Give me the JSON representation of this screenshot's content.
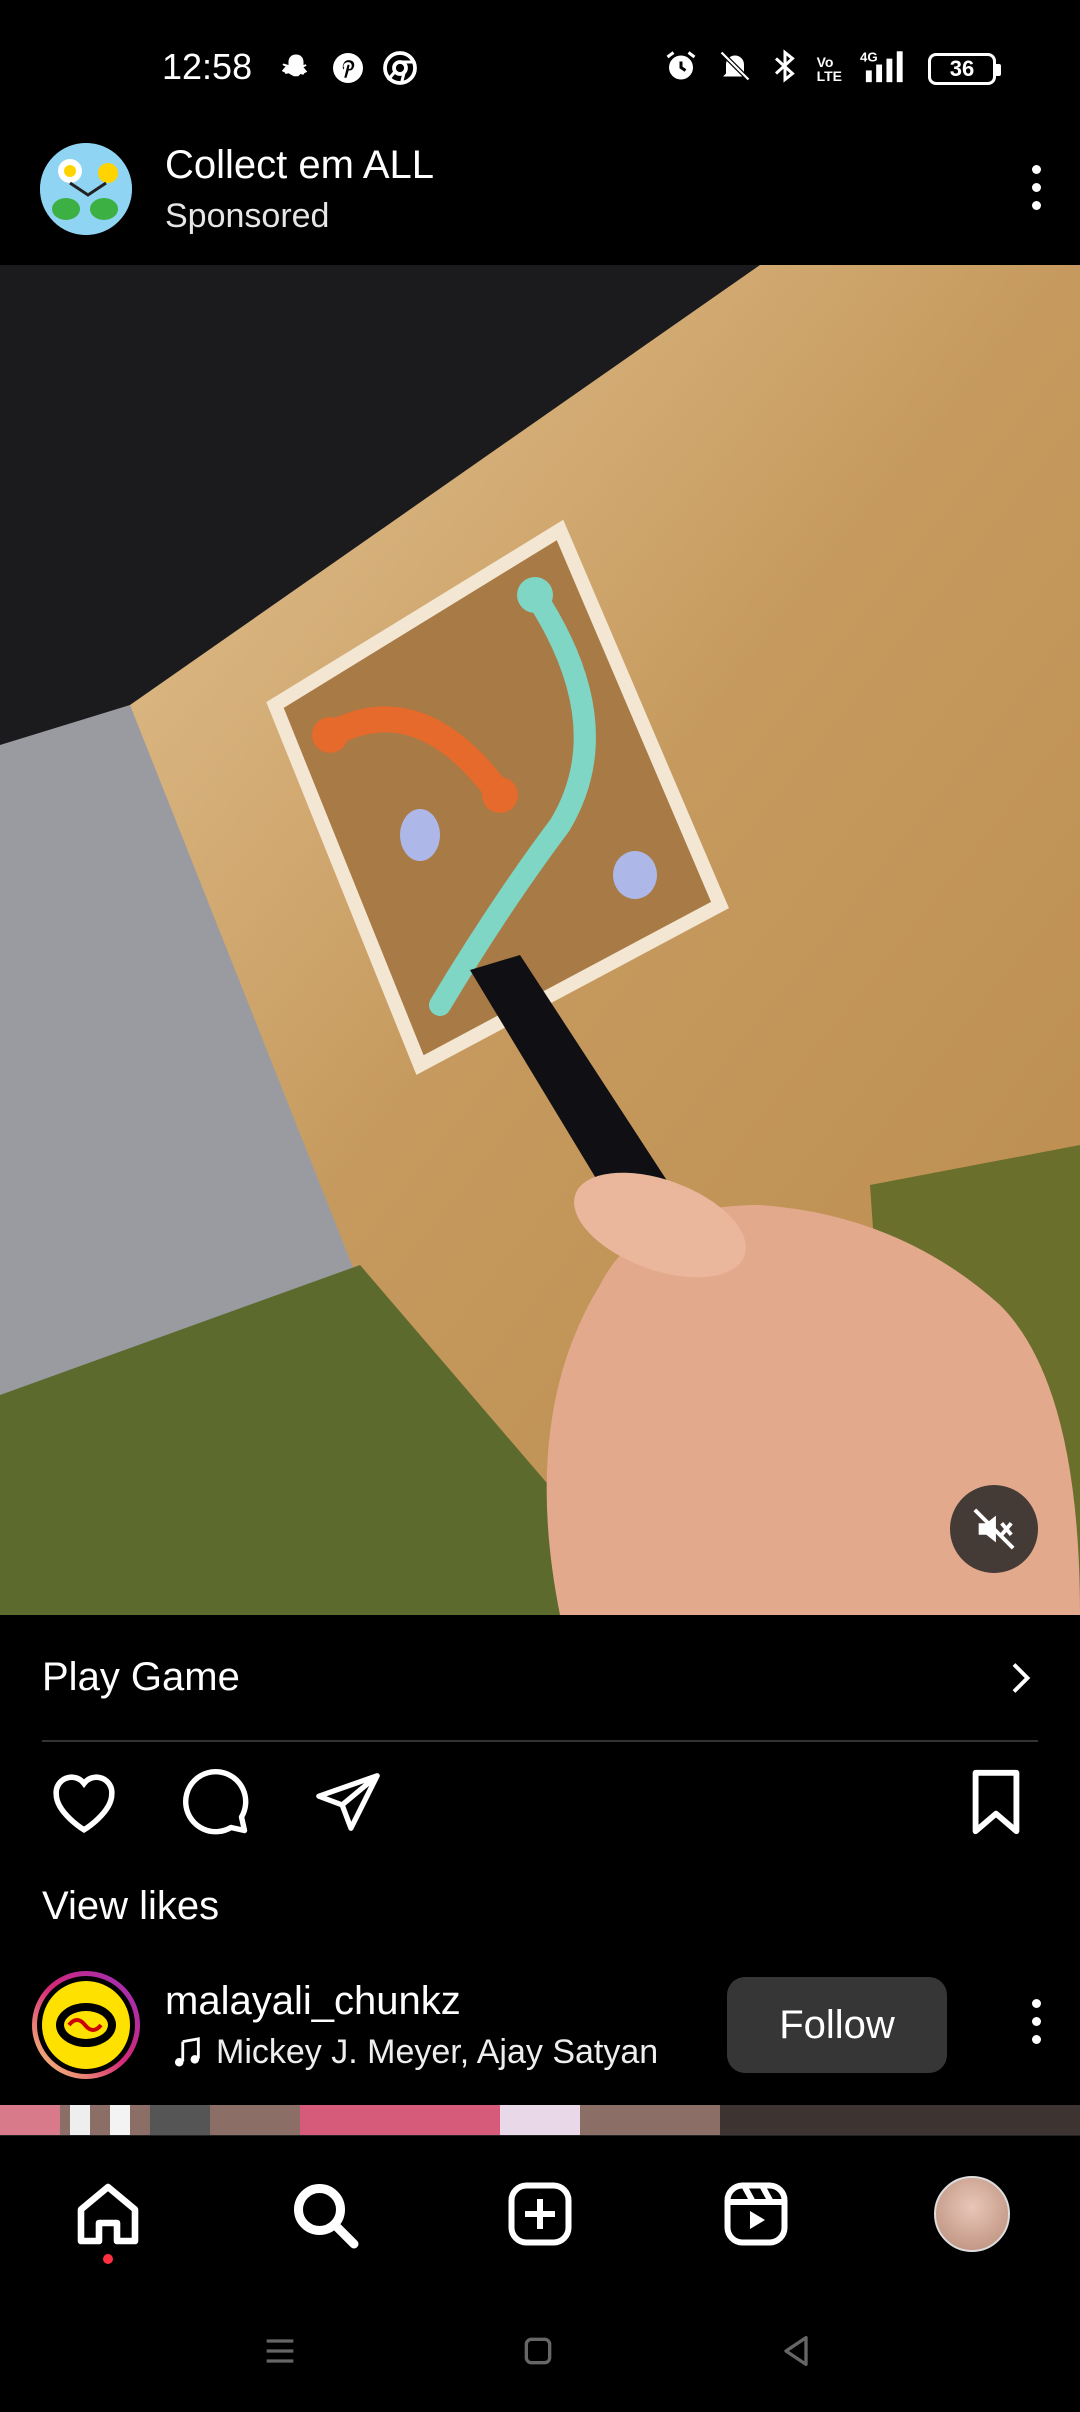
{
  "status_bar": {
    "time": "12:58",
    "battery": "36",
    "icons_left": [
      "snapchat-icon",
      "pinterest-icon",
      "chrome-icon"
    ],
    "icons_right": [
      "alarm-icon",
      "mute-icon",
      "bluetooth-icon",
      "volte-icon",
      "4g-signal-icon",
      "battery-icon"
    ]
  },
  "post": {
    "brand_name": "Collect em ALL",
    "sponsored_label": "Sponsored",
    "cta_label": "Play Game"
  },
  "actions": {
    "view_likes": "View likes"
  },
  "next_post": {
    "username": "malayali_chunkz",
    "audio": "Mickey J. Meyer, Ajay Satyan",
    "follow_label": "Follow"
  },
  "bottom_nav": {
    "items": [
      "home-icon",
      "search-icon",
      "create-icon",
      "reels-icon",
      "profile-avatar"
    ]
  },
  "colors": {
    "background": "#000000",
    "follow_button": "#363636",
    "notification_dot": "#ff3040"
  }
}
